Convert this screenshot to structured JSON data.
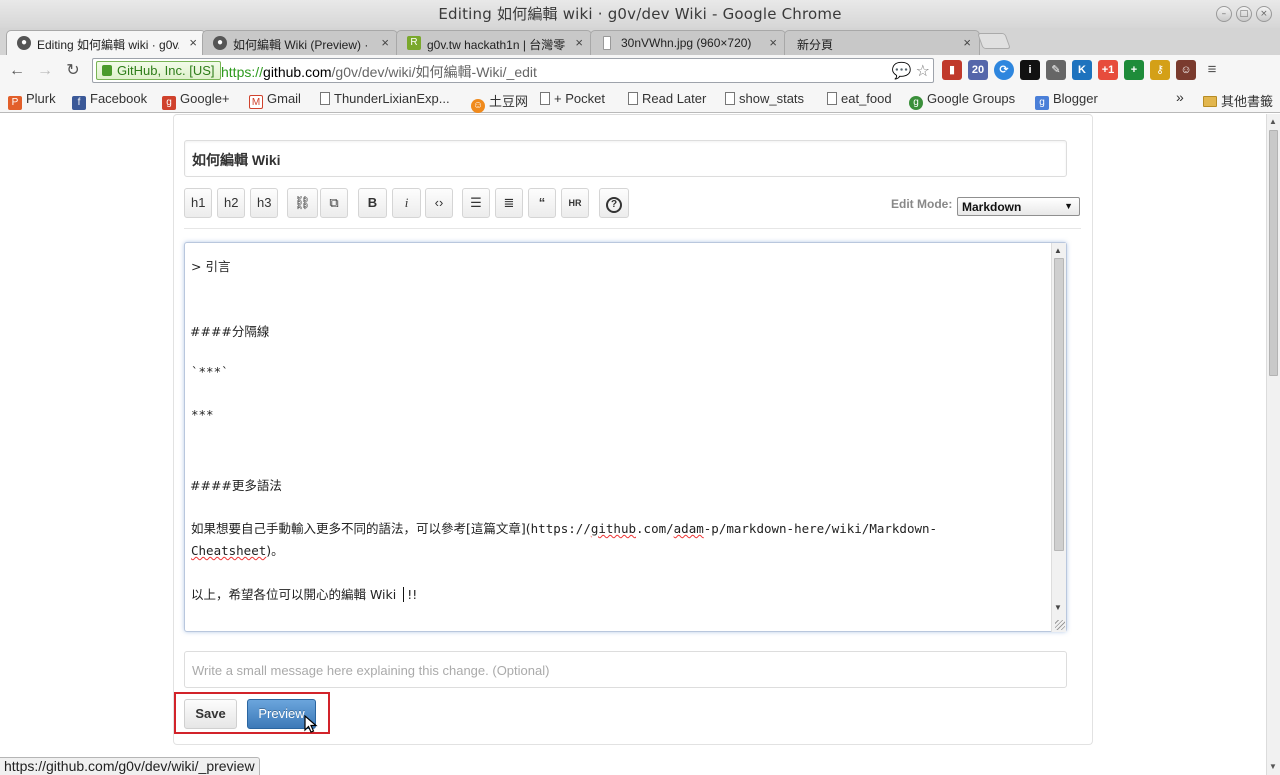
{
  "window": {
    "title": "Editing 如何編輯 wiki ·  g0v/dev Wiki - Google Chrome"
  },
  "tabs": [
    {
      "label": "Editing 如何編輯 wiki · g0v/dev",
      "favicon": "github-icon",
      "active": true
    },
    {
      "label": "如何編輯 Wiki (Preview) · g0v",
      "favicon": "github-icon",
      "active": false
    },
    {
      "label": "g0v.tw hackath1n | 台灣零時",
      "favicon": "hackpad-icon",
      "active": false
    },
    {
      "label": "30nVWhn.jpg (960×720)",
      "favicon": "image-icon",
      "active": false
    },
    {
      "label": "新分頁",
      "favicon": "",
      "active": false
    }
  ],
  "omnibox": {
    "ev_label": "GitHub, Inc. [US]",
    "scheme": "https://",
    "host": "github.com",
    "path": "/g0v/dev/wiki/如何編輯-Wiki/_edit"
  },
  "bookmarks": [
    {
      "label": "Plurk",
      "icon": "plurk-icon",
      "color": "#e25f2a"
    },
    {
      "label": "Facebook",
      "icon": "facebook-icon",
      "color": "#3b5998"
    },
    {
      "label": "Google+",
      "icon": "google-plus-icon",
      "color": "#d0422d"
    },
    {
      "label": "Gmail",
      "icon": "gmail-icon",
      "color": "#d0422d"
    },
    {
      "label": "ThunderLixianExp...",
      "icon": "document-icon",
      "color": ""
    },
    {
      "label": "土豆网",
      "icon": "tudou-icon",
      "color": "#f08a1c"
    },
    {
      "label": "+ Pocket",
      "icon": "document-icon",
      "color": ""
    },
    {
      "label": "Read Later",
      "icon": "document-icon",
      "color": ""
    },
    {
      "label": "show_stats",
      "icon": "document-icon",
      "color": ""
    },
    {
      "label": "eat_food",
      "icon": "document-icon",
      "color": ""
    },
    {
      "label": "Google Groups",
      "icon": "google-groups-icon",
      "color": "#3a8f3a"
    },
    {
      "label": "Blogger",
      "icon": "blogger-icon",
      "color": "#4a7fd8"
    }
  ],
  "bookmarks_more": "»",
  "bookmarks_other": "其他書籤",
  "editor": {
    "page_title_value": "如何編輯 Wiki",
    "toolbar": {
      "h1": "h1",
      "h2": "h2",
      "h3": "h3",
      "bold": "B",
      "italic": "i",
      "hr": "HR"
    },
    "edit_mode_label": "Edit Mode:",
    "edit_mode_value": "Markdown",
    "content_lines": {
      "l1": "> 引言",
      "l2": "####分隔線",
      "l3": "`***`",
      "l4": "***",
      "l5": "####更多語法",
      "l6_prefix": "如果想要自己手動輸入更多不同的語法，可以參考[這篇文章](",
      "l6_url_a": "https://",
      "l6_url_b": "github",
      "l6_url_c": ".com/",
      "l6_url_d": "adam",
      "l6_url_e": "-p/markdown-here/wiki/Markdown-",
      "l7_a": "Cheatsheet",
      "l7_b": ")。",
      "l8_a": "以上，希望各位可以開心的編輯 Wiki ",
      "l8_b": "!!"
    },
    "message_placeholder": "Write a small message here explaining this change. (Optional)",
    "save_label": "Save",
    "preview_label": "Preview"
  },
  "statusbar": {
    "url": "https://github.com/g0v/dev/wiki/_preview"
  },
  "colors": {
    "accent": "#3c79b8",
    "highlight": "#d2232a",
    "ev_green": "#2e7d1a"
  }
}
